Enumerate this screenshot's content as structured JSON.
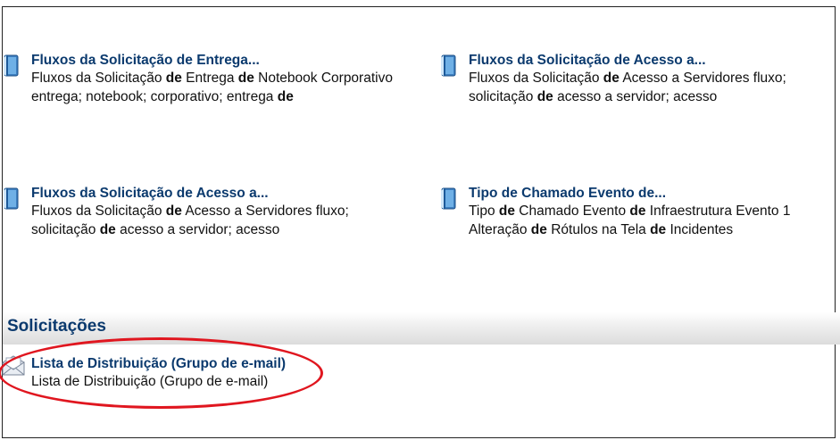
{
  "results": [
    {
      "title": "Fluxos da Solicitação de Entrega...",
      "line1": [
        {
          "t": "Fluxos da Solicitação ",
          "b": false
        },
        {
          "t": "de",
          "b": true
        },
        {
          "t": " Entrega ",
          "b": false
        },
        {
          "t": "de",
          "b": true
        },
        {
          "t": " Notebook Corporativo",
          "b": false
        }
      ],
      "line2": [
        {
          "t": "entrega; notebook; corporativo; entrega ",
          "b": false
        },
        {
          "t": "de",
          "b": true
        }
      ]
    },
    {
      "title": "Fluxos da Solicitação de Acesso a...",
      "line1": [
        {
          "t": "Fluxos da Solicitação ",
          "b": false
        },
        {
          "t": "de",
          "b": true
        },
        {
          "t": " Acesso a Servidores fluxo;",
          "b": false
        }
      ],
      "line2": [
        {
          "t": "solicitação ",
          "b": false
        },
        {
          "t": "de",
          "b": true
        },
        {
          "t": " acesso a servidor; acesso",
          "b": false
        }
      ]
    },
    {
      "title": "Fluxos da Solicitação de Acesso a...",
      "line1": [
        {
          "t": "Fluxos da Solicitação ",
          "b": false
        },
        {
          "t": "de",
          "b": true
        },
        {
          "t": " Acesso a Servidores fluxo;",
          "b": false
        }
      ],
      "line2": [
        {
          "t": "solicitação ",
          "b": false
        },
        {
          "t": "de",
          "b": true
        },
        {
          "t": " acesso a servidor; acesso",
          "b": false
        }
      ]
    },
    {
      "title": "Tipo de Chamado Evento de...",
      "line1": [
        {
          "t": "Tipo ",
          "b": false
        },
        {
          "t": "de",
          "b": true
        },
        {
          "t": " Chamado Evento ",
          "b": false
        },
        {
          "t": "de",
          "b": true
        },
        {
          "t": " Infraestrutura Evento 1",
          "b": false
        }
      ],
      "line2": [
        {
          "t": "Alteração ",
          "b": false
        },
        {
          "t": "de",
          "b": true
        },
        {
          "t": " Rótulos na Tela ",
          "b": false
        },
        {
          "t": "de",
          "b": true
        },
        {
          "t": " Incidentes",
          "b": false
        }
      ]
    }
  ],
  "section": {
    "title": "Solicitações",
    "item": {
      "title": "Lista de Distribuição (Grupo de e-mail)",
      "description": "Lista de Distribuição (Grupo de e-mail)"
    }
  },
  "icons": {
    "result_icon": "book-icon",
    "request_icon": "envelope-icon"
  },
  "colors": {
    "link": "#0b3a6e",
    "highlight": "#e0161f"
  }
}
